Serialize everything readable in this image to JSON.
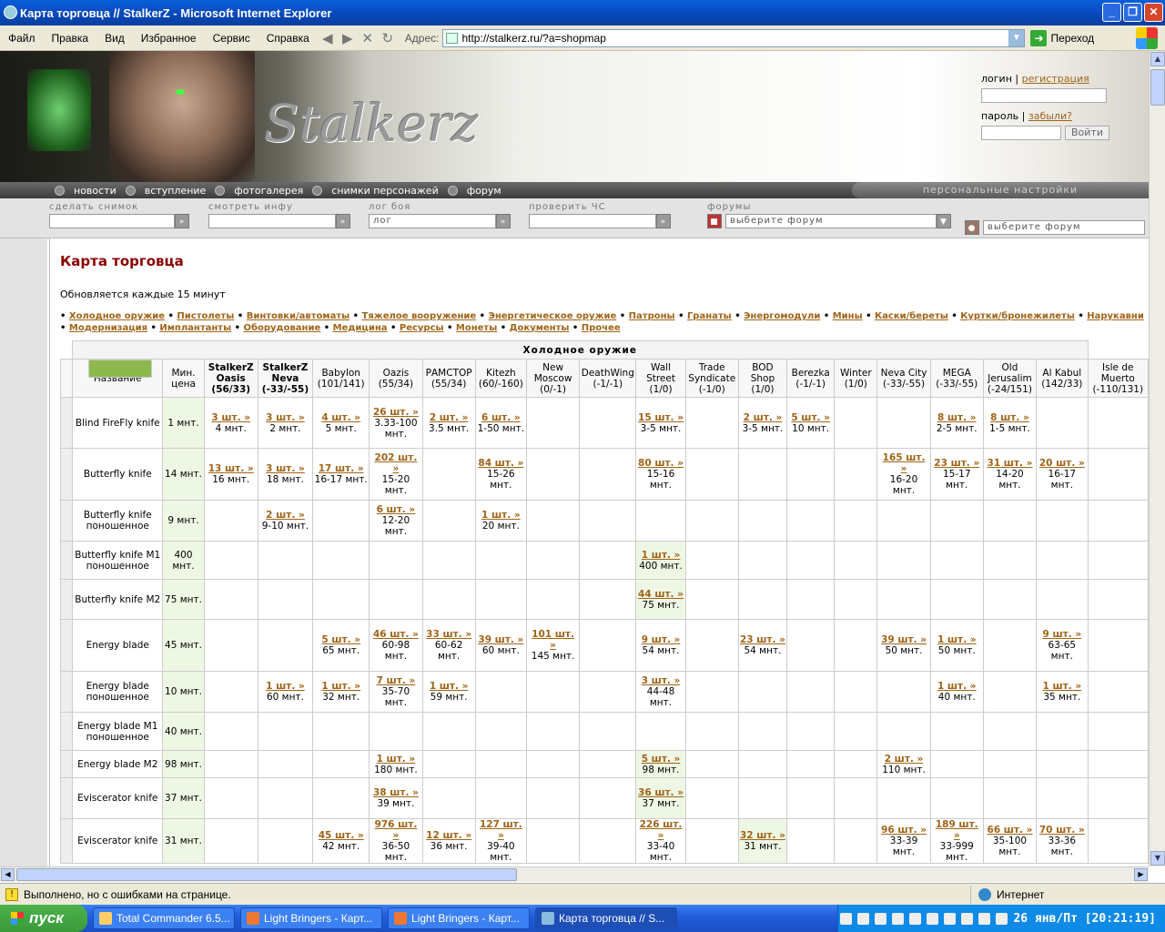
{
  "window": {
    "title": "Карта торговца // StalkerZ - Microsoft Internet Explorer"
  },
  "menu": [
    "Файл",
    "Правка",
    "Вид",
    "Избранное",
    "Сервис",
    "Справка"
  ],
  "address": {
    "label": "Адрес:",
    "url": "http://stalkerz.ru/?a=shopmap",
    "go": "Переход"
  },
  "site": {
    "logo": "Stalkerz",
    "login": {
      "login_label": "логин",
      "register": "регистрация",
      "password_label": "пароль",
      "forgot": "забыли?",
      "submit": "Войти"
    },
    "nav": [
      "новости",
      "вступление",
      "фотогалерея",
      "снимки персонажей",
      "форум"
    ],
    "personal": "персональные настройки",
    "tools": [
      {
        "label": "сделать снимок",
        "value": ""
      },
      {
        "label": "смотреть инфу",
        "value": ""
      },
      {
        "label": "лог боя",
        "value": "лог"
      },
      {
        "label": "проверить ЧС",
        "value": ""
      },
      {
        "label": "форумы",
        "value": "выберите форум"
      }
    ],
    "forum2": "выберите форум"
  },
  "main": {
    "title": "Карта торговца",
    "update_note": "Обновляется каждые 15 минут",
    "categories_line1": [
      "Холодное оружие",
      "Пистолеты",
      "Винтовки/автоматы",
      "Тяжелое вооружение",
      "Энергетическое оружие",
      "Патроны",
      "Гранаты",
      "Энергомодули",
      "Мины",
      "Каски/береты",
      "Куртки/бронежилеты",
      "Нарукавни"
    ],
    "categories_line2": [
      "Модернизация",
      "Имплантанты",
      "Оборудование",
      "Медицина",
      "Ресурсы",
      "Монеты",
      "Документы",
      "Прочее"
    ],
    "section": "Холодное оружие",
    "headers": [
      "Название",
      "Мин. цена",
      "StalkerZ Oasis (56/33)",
      "StalkerZ Neva (-33/-55)",
      "Babylon (101/141)",
      "Oazis (55/34)",
      "РАМСТОР (55/34)",
      "Kitezh (60/-160)",
      "New Moscow (0/-1)",
      "DeathWing (-1/-1)",
      "Wall Street (1/0)",
      "Trade Syndicate (-1/0)",
      "BOD Shop (1/0)",
      "Berezka (-1/-1)",
      "Winter (1/0)",
      "Neva City (-33/-55)",
      "MEGA (-33/-55)",
      "Old Jerusalim (-24/151)",
      "Al Kabul (142/33)",
      "Isle de Muerto (-110/131)"
    ],
    "rows": [
      {
        "name": "Blind FireFly knife",
        "min": "1 мнт.",
        "cells": [
          [
            "3 шт. »",
            "4 мнт."
          ],
          [
            "3 шт. »",
            "2 мнт."
          ],
          [
            "4 шт. »",
            "5 мнт."
          ],
          [
            "26 шт. »",
            "3.33-100 мнт."
          ],
          [
            "2 шт. »",
            "3.5 мнт."
          ],
          [
            "6 шт. »",
            "1-50 мнт."
          ],
          null,
          null,
          [
            "15 шт. »",
            "3-5 мнт."
          ],
          null,
          [
            "2 шт. »",
            "3-5 мнт."
          ],
          [
            "5 шт. »",
            "10 мнт."
          ],
          null,
          null,
          [
            "8 шт. »",
            "2-5 мнт."
          ],
          [
            "8 шт. »",
            "1-5 мнт."
          ],
          null,
          null
        ]
      },
      {
        "name": "Butterfly knife",
        "min": "14 мнт.",
        "cells": [
          [
            "13 шт. »",
            "16 мнт."
          ],
          [
            "3 шт. »",
            "18 мнт."
          ],
          [
            "17 шт. »",
            "16-17 мнт."
          ],
          [
            "202 шт. »",
            "15-20 мнт."
          ],
          null,
          [
            "84 шт. »",
            "15-26 мнт."
          ],
          null,
          null,
          [
            "80 шт. »",
            "15-16 мнт."
          ],
          null,
          null,
          null,
          null,
          [
            "165 шт. »",
            "16-20 мнт."
          ],
          [
            "23 шт. »",
            "15-17 мнт."
          ],
          [
            "31 шт. »",
            "14-20 мнт."
          ],
          [
            "20 шт. »",
            "16-17 мнт."
          ],
          null
        ]
      },
      {
        "name": "Butterfly knife поношенное",
        "min": "9 мнт.",
        "cells": [
          null,
          [
            "2 шт. »",
            "9-10 мнт."
          ],
          null,
          [
            "6 шт. »",
            "12-20 мнт."
          ],
          null,
          [
            "1 шт. »",
            "20 мнт."
          ],
          null,
          null,
          null,
          null,
          null,
          null,
          null,
          null,
          null,
          null,
          null,
          null
        ]
      },
      {
        "name": "Butterfly knife M1 поношенное",
        "min": "400 мнт.",
        "cells": [
          null,
          null,
          null,
          null,
          null,
          null,
          null,
          null,
          [
            "1 шт. »",
            "400 мнт."
          ],
          null,
          null,
          null,
          null,
          null,
          null,
          null,
          null,
          null
        ]
      },
      {
        "name": "Butterfly knife M2",
        "min": "75 мнт.",
        "cells": [
          null,
          null,
          null,
          null,
          null,
          null,
          null,
          null,
          [
            "44 шт. »",
            "75 мнт."
          ],
          null,
          null,
          null,
          null,
          null,
          null,
          null,
          null,
          null
        ]
      },
      {
        "name": "Energy blade",
        "min": "45 мнт.",
        "cells": [
          null,
          null,
          [
            "5 шт. »",
            "65 мнт."
          ],
          [
            "46 шт. »",
            "60-98 мнт."
          ],
          [
            "33 шт. »",
            "60-62 мнт."
          ],
          [
            "39 шт. »",
            "60 мнт."
          ],
          [
            "101 шт. »",
            "145 мнт."
          ],
          null,
          [
            "9 шт. »",
            "54 мнт."
          ],
          null,
          [
            "23 шт. »",
            "54 мнт."
          ],
          null,
          null,
          [
            "39 шт. »",
            "50 мнт."
          ],
          [
            "1 шт. »",
            "50 мнт."
          ],
          null,
          [
            "9 шт. »",
            "63-65 мнт."
          ],
          null
        ]
      },
      {
        "name": "Energy blade поношенное",
        "min": "10 мнт.",
        "cells": [
          null,
          [
            "1 шт. »",
            "60 мнт."
          ],
          [
            "1 шт. »",
            "32 мнт."
          ],
          [
            "7 шт. »",
            "35-70 мнт."
          ],
          [
            "1 шт. »",
            "59 мнт."
          ],
          null,
          null,
          null,
          [
            "3 шт. »",
            "44-48 мнт."
          ],
          null,
          null,
          null,
          null,
          null,
          [
            "1 шт. »",
            "40 мнт."
          ],
          null,
          [
            "1 шт. »",
            "35 мнт."
          ],
          null
        ]
      },
      {
        "name": "Energy blade M1 поношенное",
        "min": "40 мнт.",
        "cells": [
          null,
          null,
          null,
          null,
          null,
          null,
          null,
          null,
          null,
          null,
          null,
          null,
          null,
          null,
          null,
          null,
          null,
          null
        ]
      },
      {
        "name": "Energy blade M2",
        "min": "98 мнт.",
        "cells": [
          null,
          null,
          null,
          [
            "1 шт. »",
            "180 мнт."
          ],
          null,
          null,
          null,
          null,
          [
            "5 шт. »",
            "98 мнт."
          ],
          null,
          null,
          null,
          null,
          [
            "2 шт. »",
            "110 мнт."
          ],
          null,
          null,
          null,
          null
        ]
      },
      {
        "name": "Eviscerator knife",
        "min": "37 мнт.",
        "cells": [
          null,
          null,
          null,
          [
            "38 шт. »",
            "39 мнт."
          ],
          null,
          null,
          null,
          null,
          [
            "36 шт. »",
            "37 мнт."
          ],
          null,
          null,
          null,
          null,
          null,
          null,
          null,
          null,
          null
        ]
      },
      {
        "name": "Eviscerator knife",
        "min": "31 мнт.",
        "cells": [
          null,
          null,
          [
            "45 шт. »",
            "42 мнт."
          ],
          [
            "976 шт. »",
            "36-50 мнт."
          ],
          [
            "12 шт. »",
            "36 мнт."
          ],
          [
            "127 шт. »",
            "39-40 мнт."
          ],
          null,
          null,
          [
            "226 шт. »",
            "33-40 мнт."
          ],
          null,
          [
            "32 шт. »",
            "31 мнт."
          ],
          null,
          null,
          [
            "96 шт. »",
            "33-39 мнт."
          ],
          [
            "189 шт. »",
            "33-999 мнт."
          ],
          [
            "66 шт. »",
            "35-100 мнт."
          ],
          [
            "70 шт. »",
            "33-36 мнт."
          ],
          null
        ]
      }
    ]
  },
  "status": {
    "text": "Выполнено, но с ошибками на странице.",
    "zone": "Интернет"
  },
  "taskbar": {
    "start": "пуск",
    "tasks": [
      "Total Commander 6.5...",
      "Light Bringers - Карт...",
      "Light Bringers - Карт...",
      "Карта торговца // S..."
    ],
    "clock": "26 янв/Пт [20:21:19]"
  }
}
